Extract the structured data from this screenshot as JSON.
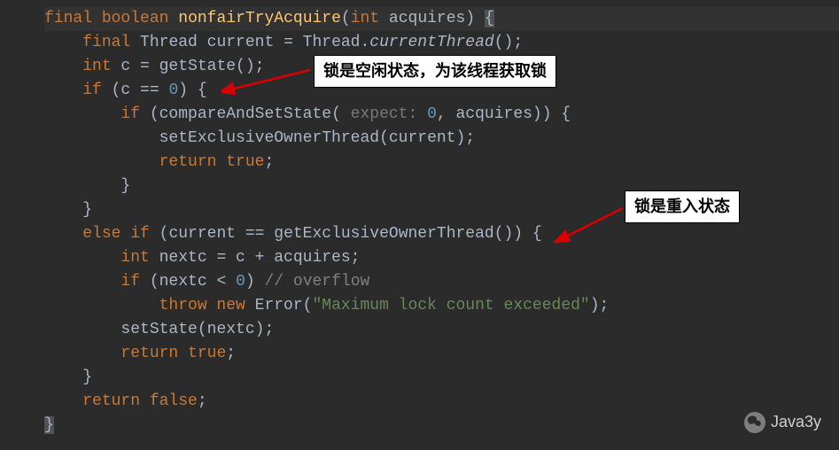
{
  "code": {
    "line1": {
      "kw_final": "final",
      "kw_boolean": "boolean",
      "method": "nonfairTryAcquire",
      "paren_open": "(",
      "kw_int": "int",
      "param": " acquires) ",
      "brace": "{"
    },
    "line2": {
      "indent": "    ",
      "kw_final": "final",
      "type": " Thread current = Thread.",
      "static_method": "currentThread",
      "rest": "();"
    },
    "line3": {
      "indent": "    ",
      "kw_int": "int",
      "rest": " c = getState();"
    },
    "line4": {
      "indent": "    ",
      "kw_if": "if",
      "cond_open": " (c == ",
      "zero": "0",
      "cond_close": ") {"
    },
    "line5": {
      "indent": "        ",
      "kw_if": "if",
      "cond_open": " (compareAndSetState(",
      "hint": " expect: ",
      "zero": "0",
      "rest": ", acquires)) {"
    },
    "line6": {
      "indent": "            ",
      "rest": "setExclusiveOwnerThread(current);"
    },
    "line7": {
      "indent": "            ",
      "kw_return": "return true",
      "semi": ";"
    },
    "line8": {
      "indent": "        ",
      "brace": "}"
    },
    "line9": {
      "indent": "    ",
      "brace": "}"
    },
    "line10": {
      "indent": "    ",
      "kw_else": "else if",
      "cond": " (current == getExclusiveOwnerThread()) {"
    },
    "line11": {
      "indent": "        ",
      "kw_int": "int",
      "rest": " nextc = c + acquires;"
    },
    "line12": {
      "indent": "        ",
      "kw_if": "if",
      "cond_open": " (nextc < ",
      "zero": "0",
      "cond_close": ") ",
      "comment": "// overflow"
    },
    "line13": {
      "indent": "            ",
      "kw_throw": "throw new",
      "err": " Error(",
      "str": "\"Maximum lock count exceeded\"",
      "rest": ");"
    },
    "line14": {
      "indent": "        ",
      "rest": "setState(nextc);"
    },
    "line15": {
      "indent": "        ",
      "kw_return": "return true",
      "semi": ";"
    },
    "line16": {
      "indent": "    ",
      "brace": "}"
    },
    "line17": {
      "indent": "    ",
      "kw_return": "return false",
      "semi": ";"
    },
    "line18": {
      "brace": "}"
    }
  },
  "annotations": {
    "anno1": "锁是空闲状态，为该线程获取锁",
    "anno2": "锁是重入状态"
  },
  "watermark": {
    "text": "Java3y"
  }
}
